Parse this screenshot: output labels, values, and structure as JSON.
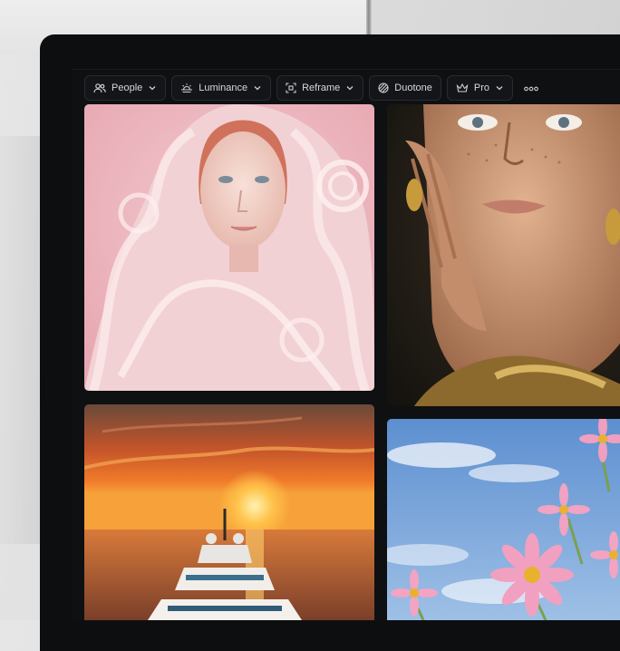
{
  "toolbar": {
    "people_label": "People",
    "luminance_label": "Luminance",
    "reframe_label": "Reframe",
    "duotone_label": "Duotone",
    "pro_label": "Pro"
  },
  "gallery": {
    "images": [
      "pink-sculptural-portrait",
      "freckled-woman-portrait",
      "yacht-at-sunset",
      "pink-flowers-sky"
    ]
  }
}
